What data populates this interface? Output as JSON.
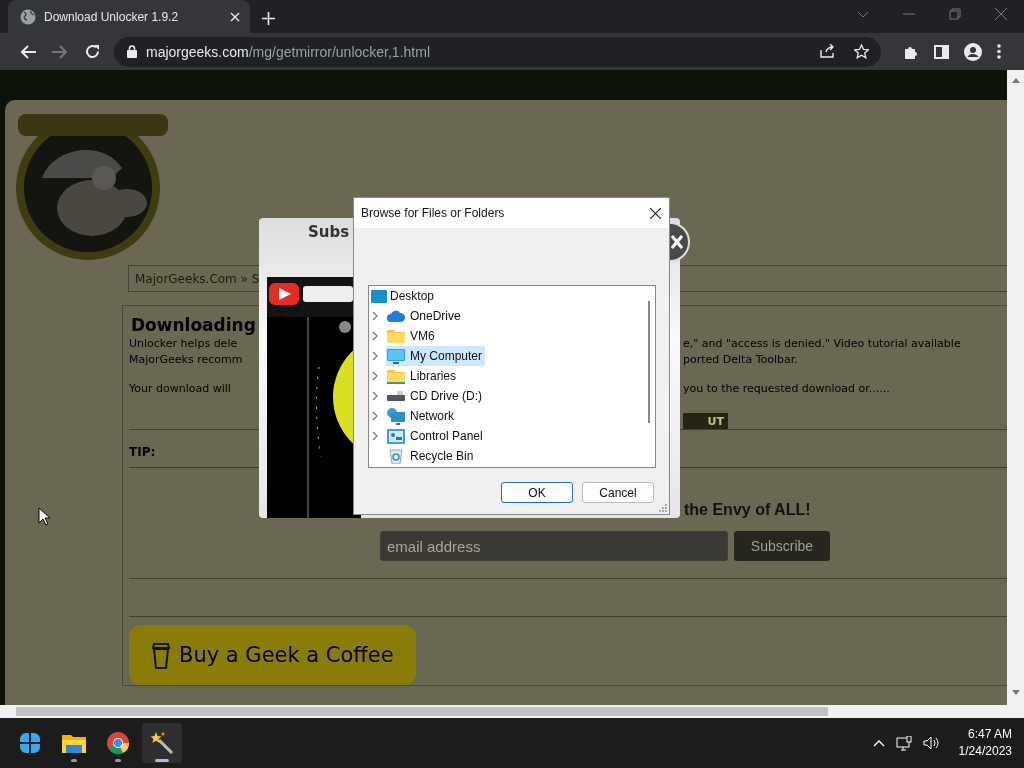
{
  "browser": {
    "tab": {
      "title": "Download Unlocker 1.9.2",
      "selected": true
    },
    "url": {
      "domain": "majorgeeks.com",
      "path": "/mg/getmirror/unlocker,1.html"
    }
  },
  "page": {
    "breadcrumb": "MajorGeeks.Com » S",
    "heading": "Downloading",
    "lines": [
      {
        "left": "Unlocker helps dele",
        "right": "e,\" and \"access is denied.\" Video tutorial available"
      },
      {
        "left": "MajorGeeks recomm",
        "right": "ported Delta Toolbar."
      },
      {
        "left": "Your download will",
        "right": "you to the requested download or......"
      }
    ],
    "cut_button": "UT",
    "tip": "TIP:",
    "newsletter_heading": "the Envy of ALL!",
    "email": {
      "placeholder": "email address"
    },
    "subscribe": "Subscribe",
    "coffee": "Buy a Geek a Coffee"
  },
  "popup": {
    "title": "Subs"
  },
  "dialog": {
    "title": "Browse for Files or Folders",
    "tree": {
      "label": "Desktop",
      "selected": false,
      "children": [
        {
          "label": "OneDrive",
          "has_children": true,
          "selected": false
        },
        {
          "label": "VM6",
          "has_children": true,
          "selected": false
        },
        {
          "label": "My Computer",
          "has_children": true,
          "selected": true
        },
        {
          "label": "Libraries",
          "has_children": true,
          "selected": false
        },
        {
          "label": "CD Drive (D:)",
          "has_children": true,
          "selected": false
        },
        {
          "label": "Network",
          "has_children": true,
          "selected": false
        },
        {
          "label": "Control Panel",
          "has_children": true,
          "selected": false
        },
        {
          "label": "Recycle Bin",
          "has_children": false,
          "selected": false
        }
      ]
    },
    "buttons": [
      {
        "label": "OK",
        "default": true
      },
      {
        "label": "Cancel",
        "default": false
      }
    ]
  },
  "taskbar": {
    "apps": [
      {
        "running": true,
        "selected": false
      },
      {
        "running": true,
        "selected": false
      },
      {
        "running": true,
        "selected": true
      }
    ],
    "time": "6:47 AM",
    "date": "1/24/2023"
  }
}
